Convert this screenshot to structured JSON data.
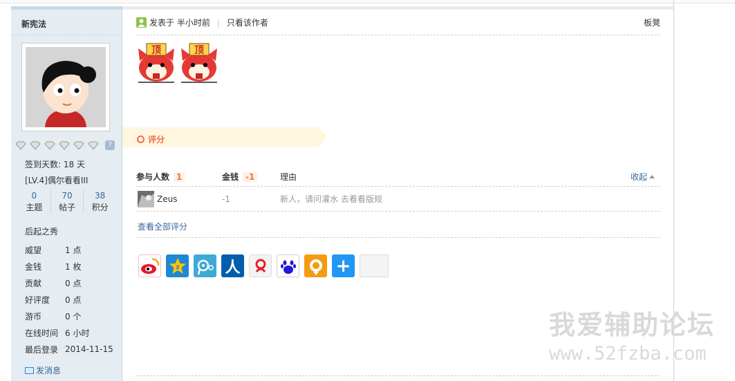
{
  "user": {
    "name": "新宪法",
    "checkin_days": "签到天数: 18 天",
    "level": "[LV.4]偶尔看看III",
    "stats": [
      {
        "num": "0",
        "label": "主题"
      },
      {
        "num": "70",
        "label": "帖子"
      },
      {
        "num": "38",
        "label": "积分"
      }
    ],
    "group": "后起之秀",
    "props": [
      {
        "key": "威望",
        "val": "1 点"
      },
      {
        "key": "金钱",
        "val": "1 枚"
      },
      {
        "key": "贡献",
        "val": "0 点"
      },
      {
        "key": "好评度",
        "val": "0 点"
      },
      {
        "key": "游币",
        "val": "0 个"
      },
      {
        "key": "在线时间",
        "val": "6 小时"
      },
      {
        "key": "最后登录",
        "val": "2014-11-15"
      }
    ],
    "send_message": "发消息",
    "medal_help": "?"
  },
  "post": {
    "posted_at": "发表于 半小时前",
    "only_author": "只看该作者",
    "floor": "板凳",
    "sticker_text": "顶"
  },
  "rating": {
    "title": "评分",
    "header_participants": "参与人数",
    "participants_count": "1",
    "header_money": "金钱",
    "money_total": "-1",
    "header_reason": "理由",
    "collapse": "收起",
    "rows": [
      {
        "user": "Zeus",
        "money": "-1",
        "reason": "新人，请问灌水 去看看版规"
      }
    ],
    "view_all": "查看全部评分"
  },
  "share": {
    "icons": [
      "weibo-icon",
      "qzone-icon",
      "tencent-weibo-icon",
      "renren-icon",
      "netease-icon",
      "baidu-icon",
      "kaixin-icon",
      "more-icon"
    ],
    "renren_text": "人",
    "more_text": "+"
  },
  "watermark": {
    "line1": "我爱辅助论坛",
    "line2": "www.52fzba.com"
  }
}
